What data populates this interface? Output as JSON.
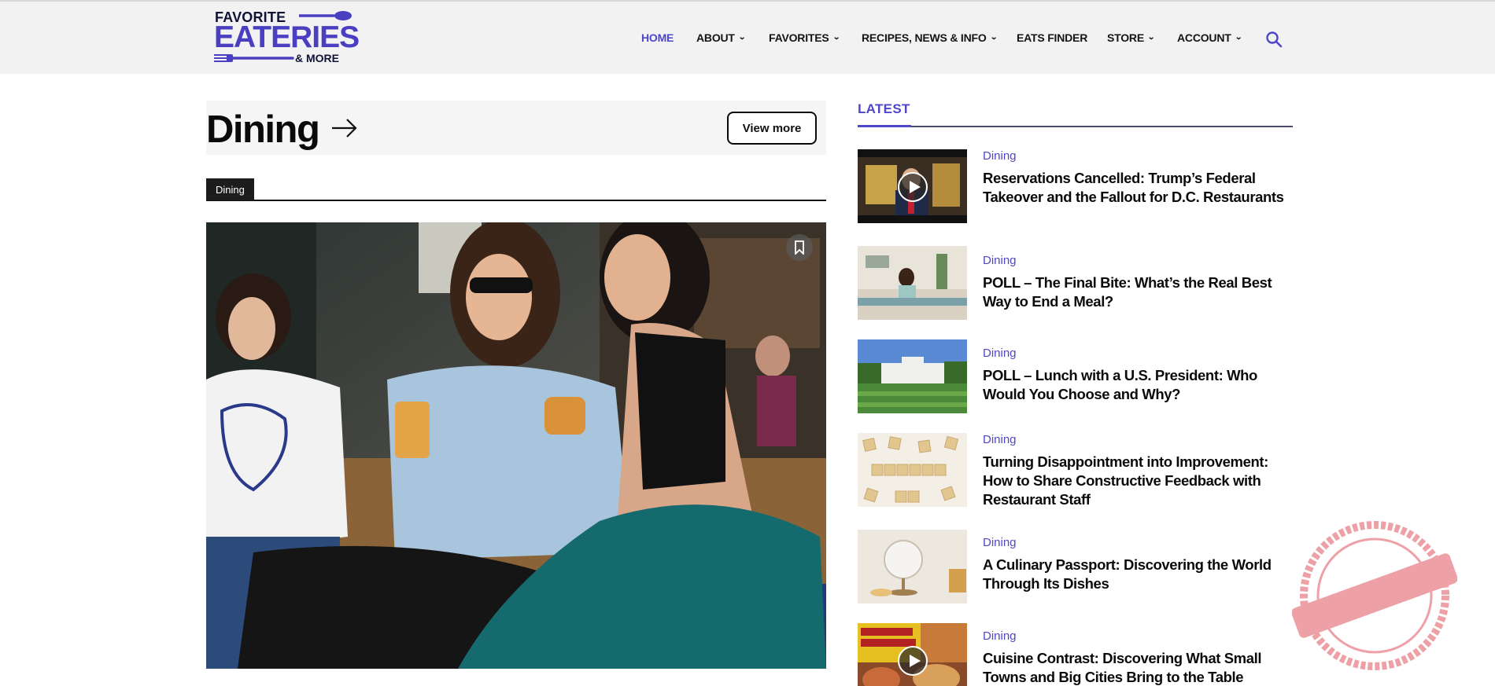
{
  "brand": {
    "line1": "FAVORITE",
    "line2": "EATERIES",
    "line3": "& MORE"
  },
  "nav": {
    "items": [
      {
        "label": "HOME",
        "dropdown": false,
        "active": true
      },
      {
        "label": "ABOUT",
        "dropdown": true
      },
      {
        "label": "FAVORITES",
        "dropdown": true
      },
      {
        "label": "RECIPES, NEWS & INFO",
        "dropdown": true
      },
      {
        "label": "EATS FINDER",
        "dropdown": false
      },
      {
        "label": "STORE",
        "dropdown": true
      },
      {
        "label": "ACCOUNT",
        "dropdown": true
      }
    ],
    "search_icon": "search-icon",
    "chevron": "⌄"
  },
  "section": {
    "title": "Dining",
    "view_more": "View more",
    "tag": "Dining"
  },
  "latest": {
    "label": "LATEST",
    "items": [
      {
        "category": "Dining",
        "title": "Reservations Cancelled: Trump’s Federal Takeover and the Fallout for D.C. Restaurants",
        "video": true
      },
      {
        "category": "Dining",
        "title": "POLL – The Final Bite: What’s the Real Best Way to End a Meal?",
        "video": false
      },
      {
        "category": "Dining",
        "title": "POLL – Lunch with a U.S. President: Who Would You Choose and Why?",
        "video": false
      },
      {
        "category": "Dining",
        "title": "Turning Disappointment into Improvement: How to Share Constructive Feedback with Restaurant Staff",
        "video": false
      },
      {
        "category": "Dining",
        "title": "A Culinary Passport: Discovering the World Through Its Dishes",
        "video": false
      },
      {
        "category": "Dining",
        "title": "Cuisine Contrast: Discovering What Small Towns and Big Cities Bring to the Table",
        "video": true
      }
    ]
  },
  "colors": {
    "accent": "#5046c8",
    "header_bg": "#f2f2f2",
    "stamp": "#e05560"
  }
}
